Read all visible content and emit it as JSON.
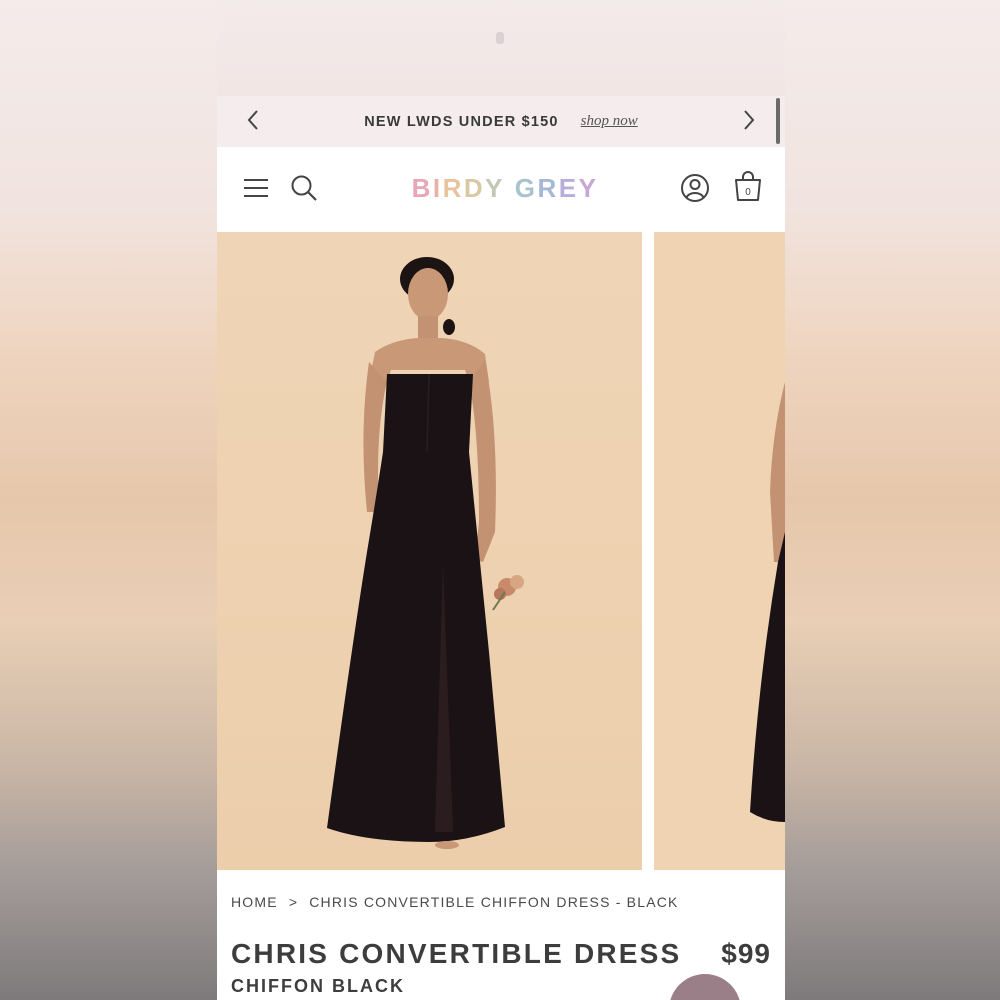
{
  "promo": {
    "text": "NEW LWDS UNDER $150",
    "link": "shop now",
    "prev_icon": "chevron-left-icon",
    "next_icon": "chevron-right-icon"
  },
  "header": {
    "logo_text": "BIRDY GREY",
    "logo_colors": [
      "#e8a6b8",
      "#e7b3a5",
      "#e9c39f",
      "#d9c9a3",
      "#c4c7b3",
      "#a9c3cc",
      "#a5b8d6",
      "#b7aed9",
      "#c7a8d5",
      "#d3a9cc"
    ],
    "menu_icon": "hamburger-menu-icon",
    "search_icon": "search-icon",
    "account_icon": "user-account-icon",
    "bag_icon": "shopping-bag-icon",
    "cart_count": "0"
  },
  "gallery": {
    "images": [
      "model-wearing-black-strapless-chiffon-dress",
      "model-side-view-black-dress"
    ],
    "background_color": "#efd3b2"
  },
  "breadcrumb": {
    "items": [
      "HOME",
      "CHRIS CONVERTIBLE CHIFFON DRESS - BLACK"
    ],
    "separator": ">"
  },
  "product": {
    "title": "CHRIS CONVERTIBLE DRESS",
    "price": "$99",
    "subtitle": "CHIFFON BLACK"
  },
  "colors": {
    "accent_chat": "#9a7f88",
    "text": "#3d3d3d",
    "promo_bg": "#f4eced"
  }
}
